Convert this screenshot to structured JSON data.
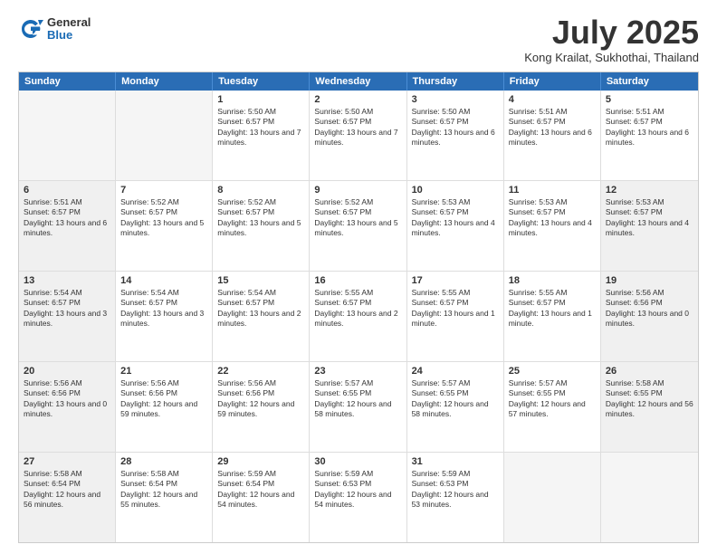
{
  "logo": {
    "general": "General",
    "blue": "Blue"
  },
  "title": "July 2025",
  "location": "Kong Krailat, Sukhothai, Thailand",
  "days_of_week": [
    "Sunday",
    "Monday",
    "Tuesday",
    "Wednesday",
    "Thursday",
    "Friday",
    "Saturday"
  ],
  "weeks": [
    [
      {
        "day": "",
        "empty": true
      },
      {
        "day": "",
        "empty": true
      },
      {
        "day": "1",
        "sunrise": "Sunrise: 5:50 AM",
        "sunset": "Sunset: 6:57 PM",
        "daylight": "Daylight: 13 hours and 7 minutes."
      },
      {
        "day": "2",
        "sunrise": "Sunrise: 5:50 AM",
        "sunset": "Sunset: 6:57 PM",
        "daylight": "Daylight: 13 hours and 7 minutes."
      },
      {
        "day": "3",
        "sunrise": "Sunrise: 5:50 AM",
        "sunset": "Sunset: 6:57 PM",
        "daylight": "Daylight: 13 hours and 6 minutes."
      },
      {
        "day": "4",
        "sunrise": "Sunrise: 5:51 AM",
        "sunset": "Sunset: 6:57 PM",
        "daylight": "Daylight: 13 hours and 6 minutes."
      },
      {
        "day": "5",
        "sunrise": "Sunrise: 5:51 AM",
        "sunset": "Sunset: 6:57 PM",
        "daylight": "Daylight: 13 hours and 6 minutes."
      }
    ],
    [
      {
        "day": "6",
        "sunrise": "Sunrise: 5:51 AM",
        "sunset": "Sunset: 6:57 PM",
        "daylight": "Daylight: 13 hours and 6 minutes.",
        "shaded": true
      },
      {
        "day": "7",
        "sunrise": "Sunrise: 5:52 AM",
        "sunset": "Sunset: 6:57 PM",
        "daylight": "Daylight: 13 hours and 5 minutes."
      },
      {
        "day": "8",
        "sunrise": "Sunrise: 5:52 AM",
        "sunset": "Sunset: 6:57 PM",
        "daylight": "Daylight: 13 hours and 5 minutes."
      },
      {
        "day": "9",
        "sunrise": "Sunrise: 5:52 AM",
        "sunset": "Sunset: 6:57 PM",
        "daylight": "Daylight: 13 hours and 5 minutes."
      },
      {
        "day": "10",
        "sunrise": "Sunrise: 5:53 AM",
        "sunset": "Sunset: 6:57 PM",
        "daylight": "Daylight: 13 hours and 4 minutes."
      },
      {
        "day": "11",
        "sunrise": "Sunrise: 5:53 AM",
        "sunset": "Sunset: 6:57 PM",
        "daylight": "Daylight: 13 hours and 4 minutes."
      },
      {
        "day": "12",
        "sunrise": "Sunrise: 5:53 AM",
        "sunset": "Sunset: 6:57 PM",
        "daylight": "Daylight: 13 hours and 4 minutes.",
        "shaded": true
      }
    ],
    [
      {
        "day": "13",
        "sunrise": "Sunrise: 5:54 AM",
        "sunset": "Sunset: 6:57 PM",
        "daylight": "Daylight: 13 hours and 3 minutes.",
        "shaded": true
      },
      {
        "day": "14",
        "sunrise": "Sunrise: 5:54 AM",
        "sunset": "Sunset: 6:57 PM",
        "daylight": "Daylight: 13 hours and 3 minutes."
      },
      {
        "day": "15",
        "sunrise": "Sunrise: 5:54 AM",
        "sunset": "Sunset: 6:57 PM",
        "daylight": "Daylight: 13 hours and 2 minutes."
      },
      {
        "day": "16",
        "sunrise": "Sunrise: 5:55 AM",
        "sunset": "Sunset: 6:57 PM",
        "daylight": "Daylight: 13 hours and 2 minutes."
      },
      {
        "day": "17",
        "sunrise": "Sunrise: 5:55 AM",
        "sunset": "Sunset: 6:57 PM",
        "daylight": "Daylight: 13 hours and 1 minute."
      },
      {
        "day": "18",
        "sunrise": "Sunrise: 5:55 AM",
        "sunset": "Sunset: 6:57 PM",
        "daylight": "Daylight: 13 hours and 1 minute."
      },
      {
        "day": "19",
        "sunrise": "Sunrise: 5:56 AM",
        "sunset": "Sunset: 6:56 PM",
        "daylight": "Daylight: 13 hours and 0 minutes.",
        "shaded": true
      }
    ],
    [
      {
        "day": "20",
        "sunrise": "Sunrise: 5:56 AM",
        "sunset": "Sunset: 6:56 PM",
        "daylight": "Daylight: 13 hours and 0 minutes.",
        "shaded": true
      },
      {
        "day": "21",
        "sunrise": "Sunrise: 5:56 AM",
        "sunset": "Sunset: 6:56 PM",
        "daylight": "Daylight: 12 hours and 59 minutes."
      },
      {
        "day": "22",
        "sunrise": "Sunrise: 5:56 AM",
        "sunset": "Sunset: 6:56 PM",
        "daylight": "Daylight: 12 hours and 59 minutes."
      },
      {
        "day": "23",
        "sunrise": "Sunrise: 5:57 AM",
        "sunset": "Sunset: 6:55 PM",
        "daylight": "Daylight: 12 hours and 58 minutes."
      },
      {
        "day": "24",
        "sunrise": "Sunrise: 5:57 AM",
        "sunset": "Sunset: 6:55 PM",
        "daylight": "Daylight: 12 hours and 58 minutes."
      },
      {
        "day": "25",
        "sunrise": "Sunrise: 5:57 AM",
        "sunset": "Sunset: 6:55 PM",
        "daylight": "Daylight: 12 hours and 57 minutes."
      },
      {
        "day": "26",
        "sunrise": "Sunrise: 5:58 AM",
        "sunset": "Sunset: 6:55 PM",
        "daylight": "Daylight: 12 hours and 56 minutes.",
        "shaded": true
      }
    ],
    [
      {
        "day": "27",
        "sunrise": "Sunrise: 5:58 AM",
        "sunset": "Sunset: 6:54 PM",
        "daylight": "Daylight: 12 hours and 56 minutes.",
        "shaded": true
      },
      {
        "day": "28",
        "sunrise": "Sunrise: 5:58 AM",
        "sunset": "Sunset: 6:54 PM",
        "daylight": "Daylight: 12 hours and 55 minutes."
      },
      {
        "day": "29",
        "sunrise": "Sunrise: 5:59 AM",
        "sunset": "Sunset: 6:54 PM",
        "daylight": "Daylight: 12 hours and 54 minutes."
      },
      {
        "day": "30",
        "sunrise": "Sunrise: 5:59 AM",
        "sunset": "Sunset: 6:53 PM",
        "daylight": "Daylight: 12 hours and 54 minutes."
      },
      {
        "day": "31",
        "sunrise": "Sunrise: 5:59 AM",
        "sunset": "Sunset: 6:53 PM",
        "daylight": "Daylight: 12 hours and 53 minutes."
      },
      {
        "day": "",
        "empty": true
      },
      {
        "day": "",
        "empty": true
      }
    ]
  ]
}
